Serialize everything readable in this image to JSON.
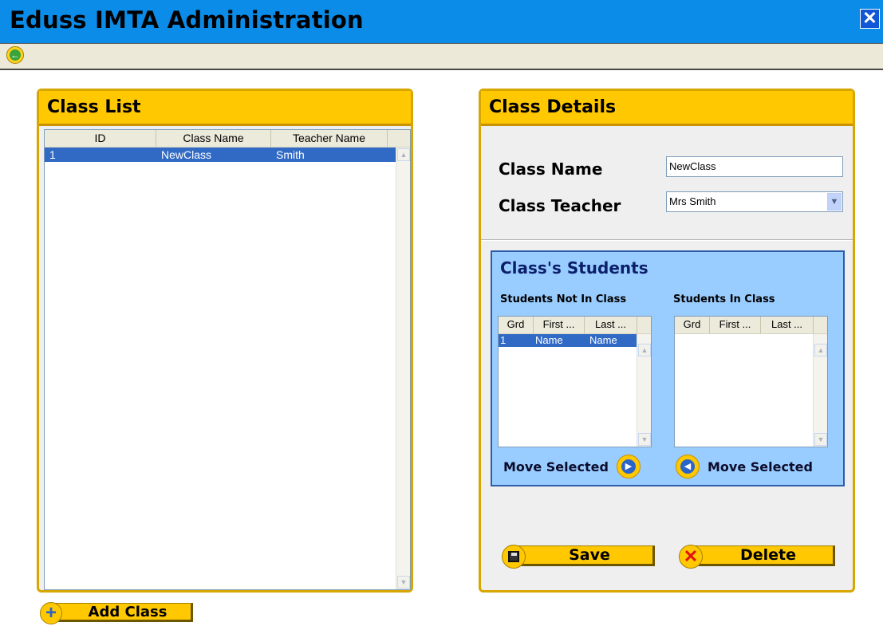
{
  "app": {
    "title": "Eduss IMTA Administration",
    "close_glyph": "✕",
    "back_icon": "arrow-left-icon"
  },
  "class_list": {
    "title": "Class List",
    "columns": [
      "ID",
      "Class Name",
      "Teacher Name"
    ],
    "rows": [
      {
        "id": "1",
        "class_name": "NewClass",
        "teacher_name": "Smith"
      }
    ],
    "add_button": "Add Class"
  },
  "class_details": {
    "title": "Class Details",
    "name_label": "Class Name",
    "name_value": "NewClass",
    "teacher_label": "Class Teacher",
    "teacher_value": "Mrs Smith",
    "students": {
      "title": "Class's Students",
      "not_in_label": "Students Not In Class",
      "in_label": "Students In Class",
      "columns": [
        "Grd",
        "First ...",
        "Last ..."
      ],
      "not_in_rows": [
        {
          "grd": "1",
          "first": "Name",
          "last": "Name"
        }
      ],
      "in_rows": [],
      "move_right_label": "Move Selected",
      "move_left_label": "Move Selected"
    },
    "save_button": "Save",
    "delete_button": "Delete"
  },
  "colors": {
    "accent": "#ffc800",
    "titlebar": "#0a8ce8",
    "selection": "#316ac5",
    "students_bg": "#99ccff"
  }
}
